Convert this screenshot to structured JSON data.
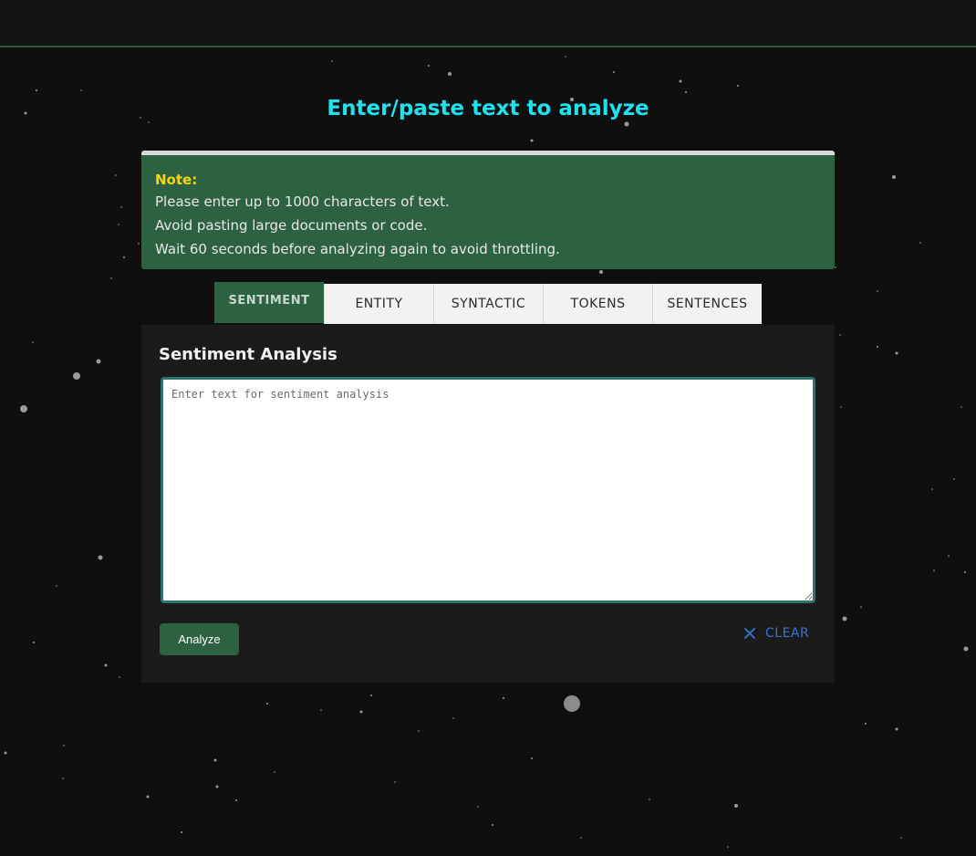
{
  "page": {
    "title": "Enter/paste text to analyze"
  },
  "note": {
    "title": "Note:",
    "lines": [
      "Please enter up to 1000 characters of text.",
      "Avoid pasting large documents or code.",
      "Wait 60 seconds before analyzing again to avoid throttling."
    ]
  },
  "tabs": [
    {
      "label": "SENTIMENT",
      "active": true
    },
    {
      "label": "ENTITY",
      "active": false
    },
    {
      "label": "SYNTACTIC",
      "active": false
    },
    {
      "label": "TOKENS",
      "active": false
    },
    {
      "label": "SENTENCES",
      "active": false
    }
  ],
  "panel": {
    "heading": "Sentiment Analysis",
    "input_placeholder": "Enter text for sentiment analysis",
    "input_value": "",
    "analyze_label": "Analyze",
    "clear_label": "CLEAR",
    "clear_icon": "close-icon"
  },
  "colors": {
    "accent_green": "#2c6242",
    "title_cyan": "#1ee3ef",
    "note_label_yellow": "#f7d512",
    "clear_blue": "#2e79cf"
  }
}
